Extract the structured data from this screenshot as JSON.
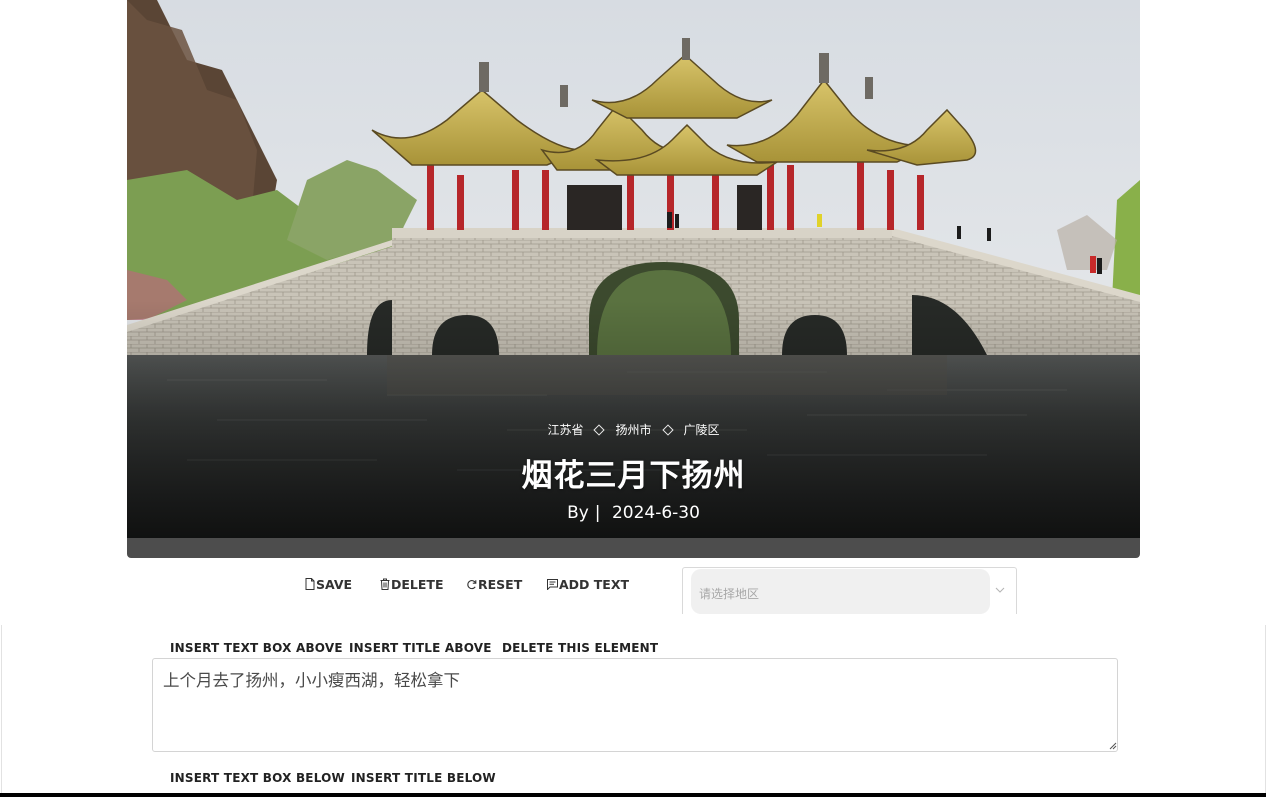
{
  "hero": {
    "regions": [
      "江苏省",
      "扬州市",
      "广陵区"
    ],
    "title": "烟花三月下扬州",
    "byline_prefix": "By",
    "byline_sep": "|",
    "date": "2024-6-30"
  },
  "toolbar": {
    "save_label": "SAVE",
    "delete_label": "DELETE",
    "reset_label": "RESET",
    "add_text_label": "ADD TEXT",
    "region_placeholder": "请选择地区"
  },
  "editor": {
    "insert_text_above": "INSERT TEXT BOX ABOVE",
    "insert_title_above": "INSERT TITLE ABOVE",
    "delete_element": "DELETE THIS ELEMENT",
    "text_content": "上个月去了扬州，小小瘦西湖，轻松拿下",
    "insert_text_below": "INSERT TEXT BOX BELOW",
    "insert_title_below": "INSERT TITLE BELOW"
  }
}
